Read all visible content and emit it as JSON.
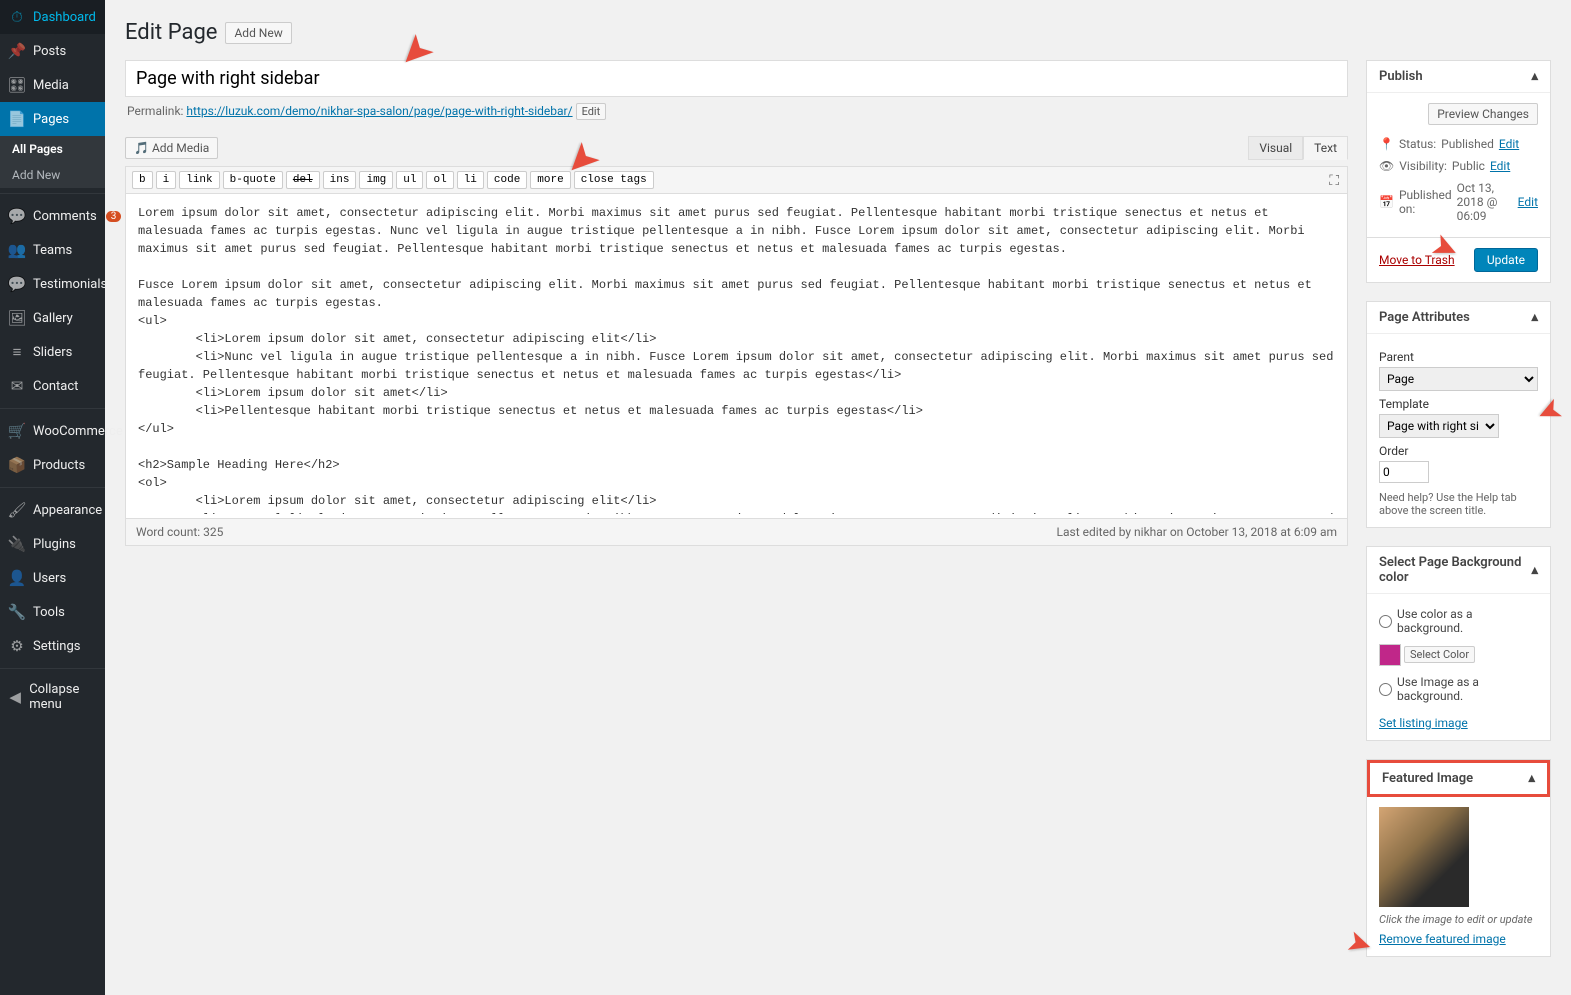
{
  "sidebar": {
    "items": [
      {
        "icon": "⏱",
        "label": "Dashboard"
      },
      {
        "icon": "📌",
        "label": "Posts"
      },
      {
        "icon": "🎛",
        "label": "Media"
      },
      {
        "icon": "📄",
        "label": "Pages",
        "current": true
      },
      {
        "icon": "💬",
        "label": "Comments",
        "badge": "3"
      },
      {
        "icon": "👥",
        "label": "Teams"
      },
      {
        "icon": "💬",
        "label": "Testimonials"
      },
      {
        "icon": "🖼",
        "label": "Gallery"
      },
      {
        "icon": "≡",
        "label": "Sliders"
      },
      {
        "icon": "✉",
        "label": "Contact"
      },
      {
        "icon": "🛒",
        "label": "WooCommerce"
      },
      {
        "icon": "📦",
        "label": "Products"
      },
      {
        "icon": "🖌",
        "label": "Appearance"
      },
      {
        "icon": "🔌",
        "label": "Plugins"
      },
      {
        "icon": "👤",
        "label": "Users"
      },
      {
        "icon": "🔧",
        "label": "Tools"
      },
      {
        "icon": "⚙",
        "label": "Settings"
      }
    ],
    "submenu": [
      "All Pages",
      "Add New"
    ],
    "collapse": "Collapse menu"
  },
  "heading": "Edit Page",
  "addNewBtn": "Add New",
  "title": "Page with right sidebar",
  "permalink": {
    "label": "Permalink:",
    "url": "https://luzuk.com/demo/nikhar-spa-salon/page/page-with-right-sidebar/",
    "edit": "Edit"
  },
  "addMedia": "Add Media",
  "tabs": {
    "visual": "Visual",
    "text": "Text"
  },
  "toolbar": [
    "b",
    "i",
    "link",
    "b-quote",
    "del",
    "ins",
    "img",
    "ul",
    "ol",
    "li",
    "code",
    "more",
    "close tags"
  ],
  "content": "Lorem ipsum dolor sit amet, consectetur adipiscing elit. Morbi maximus sit amet purus sed feugiat. Pellentesque habitant morbi tristique senectus et netus et malesuada fames ac turpis egestas. Nunc vel ligula in augue tristique pellentesque a in nibh. Fusce Lorem ipsum dolor sit amet, consectetur adipiscing elit. Morbi maximus sit amet purus sed feugiat. Pellentesque habitant morbi tristique senectus et netus et malesuada fames ac turpis egestas.\n\nFusce Lorem ipsum dolor sit amet, consectetur adipiscing elit. Morbi maximus sit amet purus sed feugiat. Pellentesque habitant morbi tristique senectus et netus et malesuada fames ac turpis egestas.\n<ul>\n \t<li>Lorem ipsum dolor sit amet, consectetur adipiscing elit</li>\n \t<li>Nunc vel ligula in augue tristique pellentesque a in nibh. Fusce Lorem ipsum dolor sit amet, consectetur adipiscing elit. Morbi maximus sit amet purus sed feugiat. Pellentesque habitant morbi tristique senectus et netus et malesuada fames ac turpis egestas</li>\n \t<li>Lorem ipsum dolor sit amet</li>\n \t<li>Pellentesque habitant morbi tristique senectus et netus et malesuada fames ac turpis egestas</li>\n</ul>\n\n<h2>Sample Heading Here</h2>\n<ol>\n \t<li>Lorem ipsum dolor sit amet, consectetur adipiscing elit</li>\n \t<li>Nunc vel ligula in augue tristique pellentesque a in nibh. Fusce Lorem ipsum dolor sit amet, consectetur adipiscing elit. Morbi maximus sit amet purus sed feugiat. Pellentesque habitant morbi tristique senectus et netus et malesuada fames ac turpis egestas</li>\n \t<li>Lorem ipsum dolor sit amet</li>\n \t<li>Pellentesque habitant morbi tristique senectus et netus et malesuada fames ac turpis egestas</li>\n</ol>\nLorem ipsum dolor sit amet, consectetur adipiscing elit. Morbi maximus sit amet purus sed feugiat. Pellentesque habitant morbi tristique senectus et netus et malesuada fames ac turpis egestas. Nunc vel ligula in augue tristique pellentesque a in nibh. Fusce Lorem ipsum dolor sit amet, consectetur adipiscing elit. Morbi maximus sit amet purus sed feugiat. Pellentesque habitant morbi tristique senectus et netus et malesuada fames ac turpis egestas.\n\nFusce Lorem ipsum dolor sit amet, consectetur adipiscing elit. Morbi maximus sit amet purus sed feugiat. Pellentesque habitant morbi tristique senectus et netus et malesuada fames ac turpis egestas.",
  "wordCount": "Word count: 325",
  "lastEdited": "Last edited by nikhar on October 13, 2018 at 6:09 am",
  "publish": {
    "title": "Publish",
    "preview": "Preview Changes",
    "status": {
      "label": "Status:",
      "value": "Published",
      "edit": "Edit"
    },
    "visibility": {
      "label": "Visibility:",
      "value": "Public",
      "edit": "Edit"
    },
    "published": {
      "label": "Published on:",
      "value": "Oct 13, 2018 @ 06:09",
      "edit": "Edit"
    },
    "trash": "Move to Trash",
    "update": "Update"
  },
  "attrs": {
    "title": "Page Attributes",
    "parent": {
      "label": "Parent",
      "value": "Page"
    },
    "template": {
      "label": "Template",
      "value": "Page with right sidebar"
    },
    "order": {
      "label": "Order",
      "value": "0"
    },
    "help": "Need help? Use the Help tab above the screen title."
  },
  "bgcolor": {
    "title": "Select Page Background color",
    "opt1": "Use color as a background.",
    "selectColor": "Select Color",
    "opt2": "Use Image as a background.",
    "setImg": "Set listing image"
  },
  "featured": {
    "title": "Featured Image",
    "note": "Click the image to edit or update",
    "remove": "Remove featured image"
  }
}
